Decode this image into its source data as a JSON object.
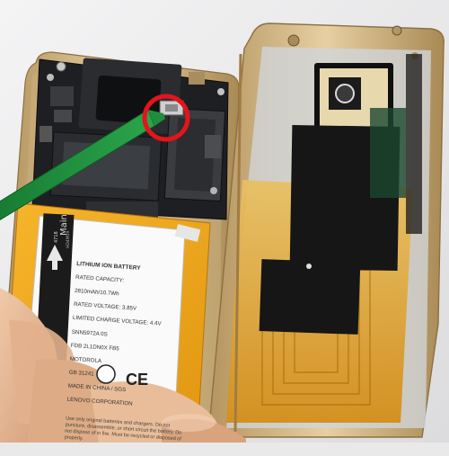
{
  "photo": {
    "cable_label_main": "Main",
    "cable_label_code": "4718",
    "cable_label_serial": "HD4M19",
    "battery_label": {
      "heading": "LITHIUM ION BATTERY",
      "lines": [
        "RATED CAPACITY:",
        "2810mAh/10.7Wh",
        "RATED VOLTAGE: 3.85V",
        "LIMITED CHARGE VOLTAGE: 4.4V",
        "SNN5972A 0S",
        "FDB 2L1DN0X FB5",
        "MOTOROLA",
        "GB 31241",
        "MADE IN CHINA / SGS",
        "LENOVO CORPORATION"
      ],
      "warning": "Use only original batteries and chargers. Do not puncture, disassemble, or short circuit the battery. Do not dispose of in fire. Must be recycled or disposed of properly."
    },
    "colors": {
      "frame_gold": "#d4b888",
      "battery_orange": "#f2a81c",
      "pcb_black": "#1e1f22",
      "pry_tool_green": "#1f8f3f",
      "highlight_red": "#e5141c",
      "tape_black": "#161616"
    }
  }
}
